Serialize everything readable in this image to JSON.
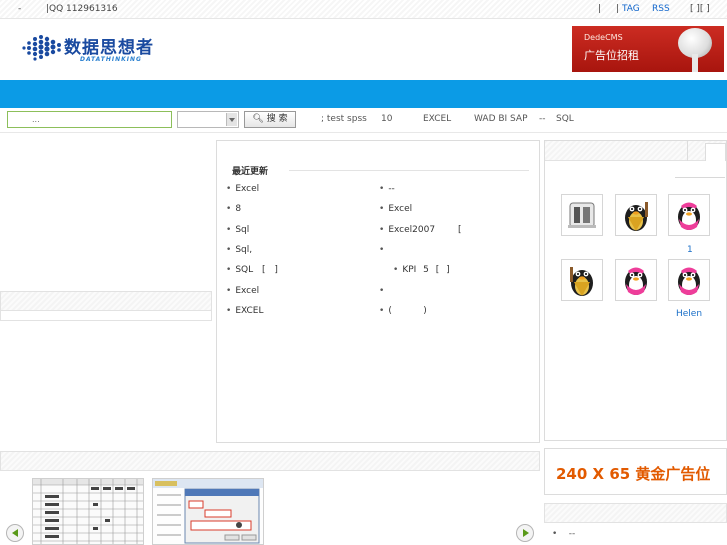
{
  "topbar": {
    "dash": "-",
    "qq": "|QQ 112961316",
    "sep": "|",
    "tag_sep": "|",
    "tag": "TAG",
    "rss": "RSS",
    "brackets": "[  ][  ]"
  },
  "logo": {
    "cn": "数据思想者",
    "en": "DATATHINKING"
  },
  "header_ad": {
    "line1": "DedeCMS",
    "line2": "广告位招租"
  },
  "search": {
    "input_value": "...",
    "button_label": "搜 索",
    "hot_words": [
      "; test spss",
      "10",
      "EXCEL",
      "WAD BI SAP",
      "--",
      "SQL"
    ]
  },
  "recent": {
    "title": "最近更新",
    "left_items": [
      "Excel",
      "8",
      "Sql",
      "Sql,",
      "SQL  [ ]",
      "Excel",
      "EXCEL"
    ],
    "right_items": [
      "--",
      "Excel",
      "Excel2007        [",
      "",
      "KPI 5   [ ]",
      "",
      "(           )"
    ]
  },
  "members": {
    "names": [
      "",
      "",
      "1",
      "",
      "",
      "Helen"
    ]
  },
  "bottom_ad": {
    "text": "240 X 65 黄金广告位"
  },
  "right_bottom": {
    "item": "--"
  },
  "colors": {
    "nav": "#0b9be6",
    "ad_red": "#cc2c22",
    "gold_text": "#e25a00"
  }
}
